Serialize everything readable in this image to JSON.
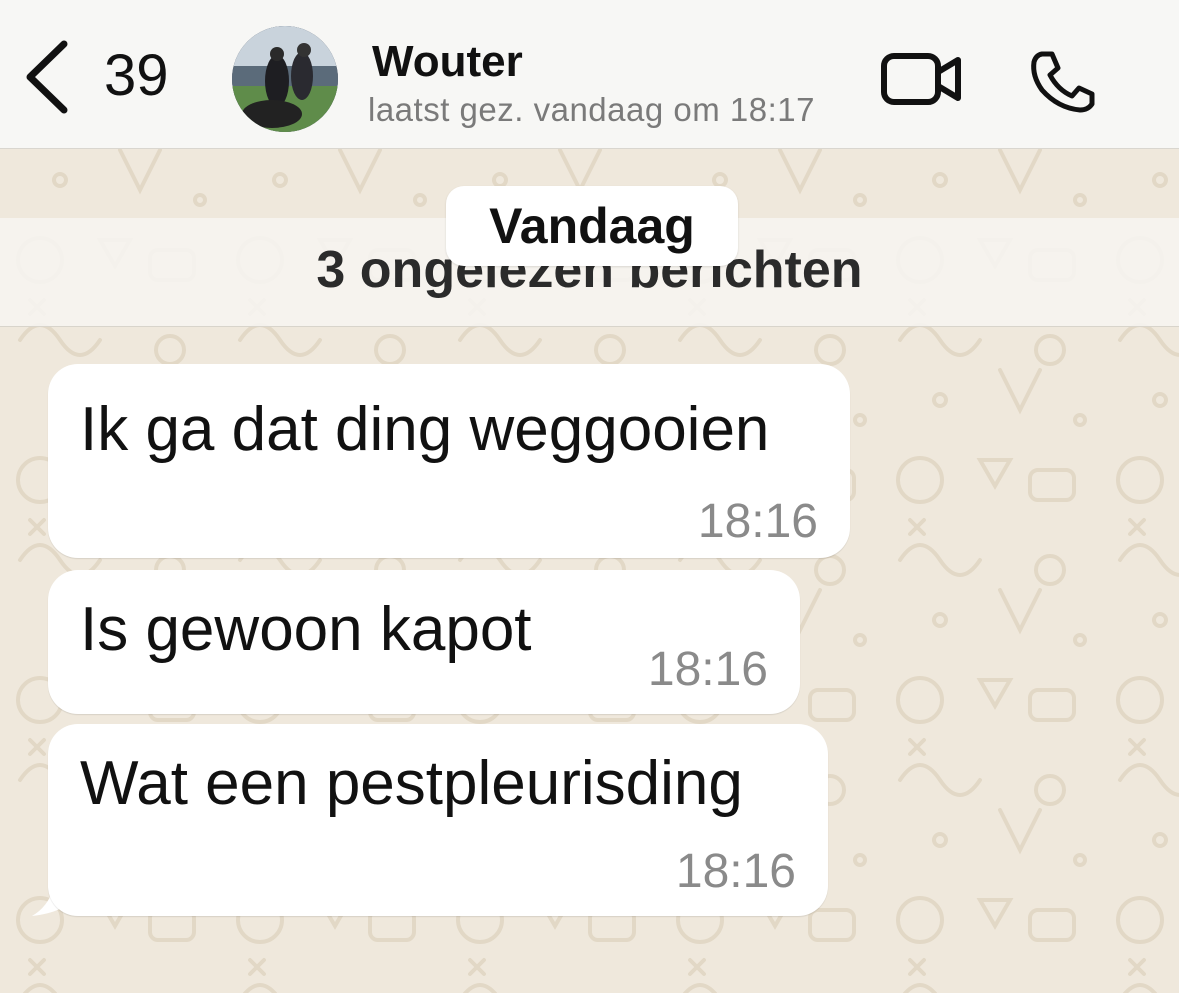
{
  "header": {
    "back_count": "39",
    "contact_name": "Wouter",
    "status": "laatst gez. vandaag om 18:17",
    "back_icon": "chevron-left-icon",
    "video_icon": "video-camera-icon",
    "call_icon": "phone-icon"
  },
  "chat": {
    "date_label": "Vandaag",
    "unread_label": "3 ongelezen berichten",
    "messages": [
      {
        "text": "Ik ga dat ding weggooien",
        "time": "18:16"
      },
      {
        "text": "Is gewoon kapot",
        "time": "18:16"
      },
      {
        "text": "Wat een pestpleurisding",
        "time": "18:16"
      }
    ]
  },
  "colors": {
    "wallpaper": "#efe8dc",
    "bubble": "#ffffff",
    "timestamp": "#8a8a8a"
  }
}
